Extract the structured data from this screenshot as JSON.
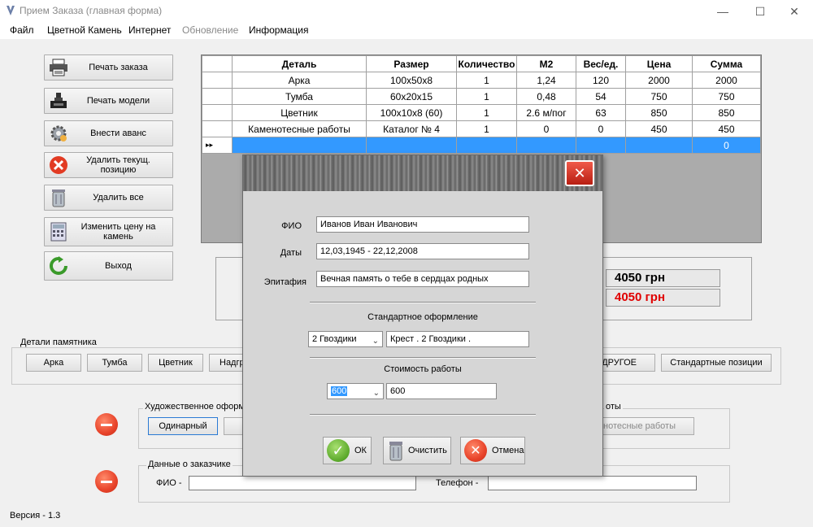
{
  "window": {
    "title": "Прием Заказа (главная форма)"
  },
  "menu": [
    "Файл",
    "Цветной Камень",
    "Интернет",
    "Обновление",
    "Информация"
  ],
  "left_buttons": [
    {
      "label": "Печать заказа",
      "icon": "printer-icon"
    },
    {
      "label": "Печать модели",
      "icon": "model-print-icon"
    },
    {
      "label": "Внести аванс",
      "icon": "gear-icon"
    },
    {
      "label": "Удалить текущ. позицию",
      "icon": "delete-x-icon"
    },
    {
      "label": "Удалить все",
      "icon": "trash-icon"
    },
    {
      "label": "Изменить цену на камень",
      "icon": "calculator-icon"
    },
    {
      "label": "Выход",
      "icon": "refresh-exit-icon"
    }
  ],
  "grid": {
    "headers": [
      "Деталь",
      "Размер",
      "Количество",
      "М2",
      "Вес/ед.",
      "Цена",
      "Сумма"
    ],
    "rows": [
      [
        "Арка",
        "100x50x8",
        "1",
        "1,24",
        "120",
        "2000",
        "2000"
      ],
      [
        "Тумба",
        "60x20x15",
        "1",
        "0,48",
        "54",
        "750",
        "750"
      ],
      [
        "Цветник",
        "100x10x8 (60)",
        "1",
        "2.6 м/пог",
        "63",
        "850",
        "850"
      ],
      [
        "Каменотесные работы",
        "Каталог № 4",
        "1",
        "0",
        "0",
        "450",
        "450"
      ],
      [
        "",
        "",
        "",
        "",
        "",
        "",
        "0"
      ]
    ],
    "row_marker": "▸▸"
  },
  "totals": {
    "total1": "4050 грн",
    "total2": "4050 грн",
    "total2_color": "#e00000"
  },
  "details_group": {
    "label": "Детали памятника",
    "buttons": [
      "Арка",
      "Тумба",
      "Цветник",
      "Надгр"
    ],
    "right_buttons": [
      "ДРУГОЕ",
      "Стандартные позиции"
    ]
  },
  "art_group": {
    "label": "Художественное оформле",
    "button": "Одинарный"
  },
  "works_group": {
    "label": "оты",
    "button": "каменотесные работы"
  },
  "customer_group": {
    "label": "Данные о заказчике",
    "fio_label": "ФИО -",
    "phone_label": "Телефон -"
  },
  "version": "Версия - 1.3",
  "dialog": {
    "fio_label": "ФИО",
    "fio_value": "Иванов Иван Иванович",
    "dates_label": "Даты",
    "dates_value": "12,03,1945 - 22,12,2008",
    "epitaph_label": "Эпитафия",
    "epitaph_value": "Вечная память о тебе в сердцах родных",
    "standard_label": "Стандартное оформление",
    "standard_select": "2 Гвоздики",
    "standard_value": "Крест . 2 Гвоздики .",
    "cost_label": "Стоимость работы",
    "cost_select": "600",
    "cost_value": "600",
    "ok_label": "ОК",
    "clear_label": "Очистить",
    "cancel_label": "Отмена"
  }
}
